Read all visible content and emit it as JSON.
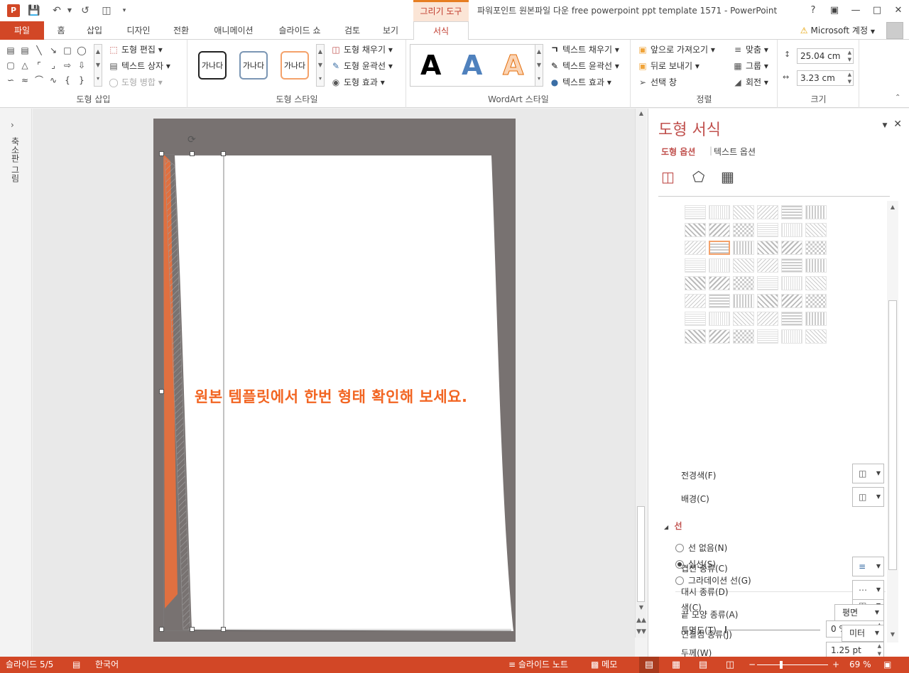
{
  "title_bar": {
    "drawing_tools": "그리기 도구",
    "window_title": "파워포인트 원본파일 다운 free powerpoint ppt template 1571 - PowerPoint",
    "help": "?",
    "logo": "P"
  },
  "tabs": {
    "file": "파일",
    "items": [
      "홈",
      "삽입",
      "디자인",
      "전환",
      "애니메이션",
      "슬라이드 쇼",
      "검토",
      "보기"
    ],
    "format": "서식",
    "account": "Microsoft 계정"
  },
  "ribbon": {
    "insert_shapes": {
      "label": "도형 삽입",
      "edit_shape": "도형 편집",
      "text_box": "텍스트 상자",
      "merge_shapes": "도형 병합"
    },
    "shape_styles": {
      "label": "도형 스타일",
      "sample_text": "가나다",
      "fill": "도형 채우기",
      "outline": "도형 윤곽선",
      "effects": "도형 효과"
    },
    "wordart": {
      "label": "WordArt 스타일",
      "letter": "A",
      "text_fill": "텍스트 채우기",
      "text_outline": "텍스트 윤곽선",
      "text_effects": "텍스트 효과"
    },
    "arrange": {
      "label": "정렬",
      "bring_forward": "앞으로 가져오기",
      "send_backward": "뒤로 보내기",
      "selection_pane": "선택 창",
      "align": "맞춤",
      "group": "그룹",
      "rotate": "회전"
    },
    "size": {
      "label": "크기",
      "height": "25.04 cm",
      "width": "3.23 cm"
    }
  },
  "thumbnail_strip": {
    "label": "축소판 그림",
    "toggle": "›"
  },
  "slide": {
    "text": "원본 템플릿에서 한번 형태 확인해 보세요."
  },
  "format_pane": {
    "title": "도형 서식",
    "tab_shape": "도형 옵션",
    "tab_text": "텍스트 옵션",
    "foreground": "전경색(F)",
    "background": "배경(C)",
    "line_section": "선",
    "line_none": "선 없음(N)",
    "line_solid": "실선(S)",
    "line_gradient": "그라데이션 선(G)",
    "color": "색(C)",
    "transparency": "투명도(T)",
    "transparency_value": "0 %",
    "width": "두께(W)",
    "width_value": "1.25 pt",
    "compound_type": "겹선 종류(C)",
    "dash_type": "대시 종류(D)",
    "cap_type": "끝 모양 종류(A)",
    "cap_value": "평면",
    "join_type": "연결점 종류(J)",
    "join_value": "미터"
  },
  "status_bar": {
    "slide_info": "슬라이드 5/5",
    "language": "한국어",
    "notes": "슬라이드 노트",
    "comments": "메모",
    "zoom_out": "−",
    "zoom_in": "+",
    "zoom": "69 %"
  },
  "colors": {
    "accent": "#d24726",
    "slide_text": "#f26522",
    "slide_bg": "#787271"
  }
}
